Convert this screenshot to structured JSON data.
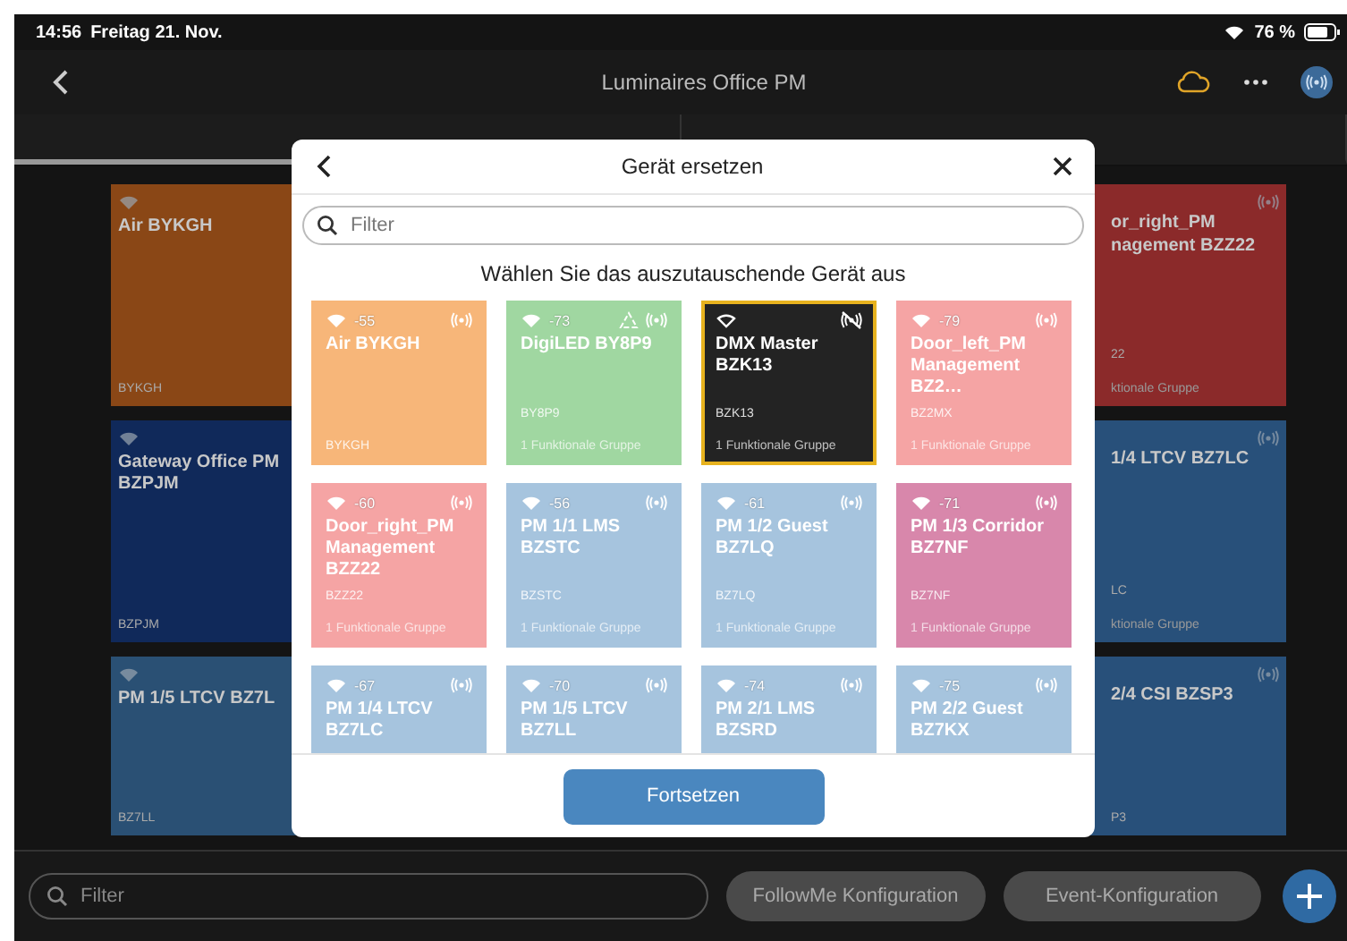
{
  "status_bar": {
    "time": "14:56",
    "date": "Freitag 21. Nov.",
    "battery": "76 %"
  },
  "nav": {
    "title": "Luminaires Office PM"
  },
  "tabs": [
    {
      "selected": true
    },
    {
      "selected": false
    }
  ],
  "background_rows": [
    {
      "left": {
        "name": "Air BYKGH",
        "code": "BYKGH",
        "color": "#8a4716"
      },
      "right": {
        "name_lines": [
          "or_right_PM",
          "nagement BZZ22"
        ],
        "code": "22",
        "group": "ktionale Gruppe",
        "color": "#8b2a2a"
      }
    },
    {
      "left": {
        "name": "Gateway Office PM BZPJM",
        "code": "BZPJM",
        "color": "#10295a"
      },
      "right": {
        "name_lines": [
          "1/4 LTCV BZ7LC"
        ],
        "code": "LC",
        "group": "ktionale Gruppe",
        "color": "#28507a"
      }
    },
    {
      "left": {
        "name": "PM 1/5 LTCV BZ7L",
        "code": "BZ7LL",
        "color": "#2a5074"
      },
      "right": {
        "name_lines": [
          "2/4 CSI BZSP3"
        ],
        "code": "P3",
        "color": "#28507a"
      }
    }
  ],
  "dialog": {
    "title": "Gerät ersetzen",
    "filter_placeholder": "Filter",
    "heading": "Wählen Sie das auszutauschende Gerät aus",
    "tiles": [
      {
        "signal": "-55",
        "name": "Air BYKGH",
        "code": "BYKGH",
        "color": "#f7b679",
        "selected": false,
        "beacon_muted": false,
        "shared": false
      },
      {
        "signal": "-73",
        "name": "DigiLED BY8P9",
        "code": "BY8P9",
        "group": "1 Funktionale Gruppe",
        "color": "#a0d7a1",
        "selected": false,
        "beacon_muted": false,
        "shared": true
      },
      {
        "name": "DMX Master BZK13",
        "code": "BZK13",
        "group": "1 Funktionale Gruppe",
        "color": "#232323",
        "selected": true,
        "beacon_muted": true,
        "shared": false
      },
      {
        "signal": "-79",
        "name": "Door_left_PM Management BZ2…",
        "code": "BZ2MX",
        "group": "1 Funktionale Gruppe",
        "color": "#f5a4a4",
        "selected": false,
        "beacon_muted": false,
        "shared": false
      },
      {
        "signal": "-60",
        "name": "Door_right_PM Management BZZ22",
        "code": "BZZ22",
        "group": "1 Funktionale Gruppe",
        "color": "#f5a4a4",
        "selected": false,
        "beacon_muted": false,
        "shared": false
      },
      {
        "signal": "-56",
        "name": "PM 1/1  LMS BZSTC",
        "code": "BZSTC",
        "group": "1 Funktionale Gruppe",
        "color": "#a6c4de",
        "selected": false,
        "beacon_muted": false,
        "shared": false
      },
      {
        "signal": "-61",
        "name": "PM 1/2 Guest BZ7LQ",
        "code": "BZ7LQ",
        "group": "1 Funktionale Gruppe",
        "color": "#a6c4de",
        "selected": false,
        "beacon_muted": false,
        "shared": false
      },
      {
        "signal": "-71",
        "name": "PM 1/3 Corridor BZ7NF",
        "code": "BZ7NF",
        "group": "1 Funktionale Gruppe",
        "color": "#d887ab",
        "selected": false,
        "beacon_muted": false,
        "shared": false
      },
      {
        "signal": "-67",
        "name": "PM 1/4 LTCV BZ7LC",
        "color": "#a6c4de",
        "selected": false,
        "beacon_muted": false,
        "shared": false
      },
      {
        "signal": "-70",
        "name": "PM 1/5 LTCV BZ7LL",
        "color": "#a6c4de",
        "selected": false,
        "beacon_muted": false,
        "shared": false
      },
      {
        "signal": "-74",
        "name": "PM 2/1 LMS BZSRD",
        "color": "#a6c4de",
        "selected": false,
        "beacon_muted": false,
        "shared": false
      },
      {
        "signal": "-75",
        "name": "PM 2/2 Guest BZ7KX",
        "color": "#a6c4de",
        "selected": false,
        "beacon_muted": false,
        "shared": false
      }
    ],
    "button": "Fortsetzen"
  },
  "bottom_bar": {
    "filter_placeholder": "Filter",
    "buttons": [
      "FollowMe Konfiguration",
      "Event-Konfiguration"
    ]
  }
}
